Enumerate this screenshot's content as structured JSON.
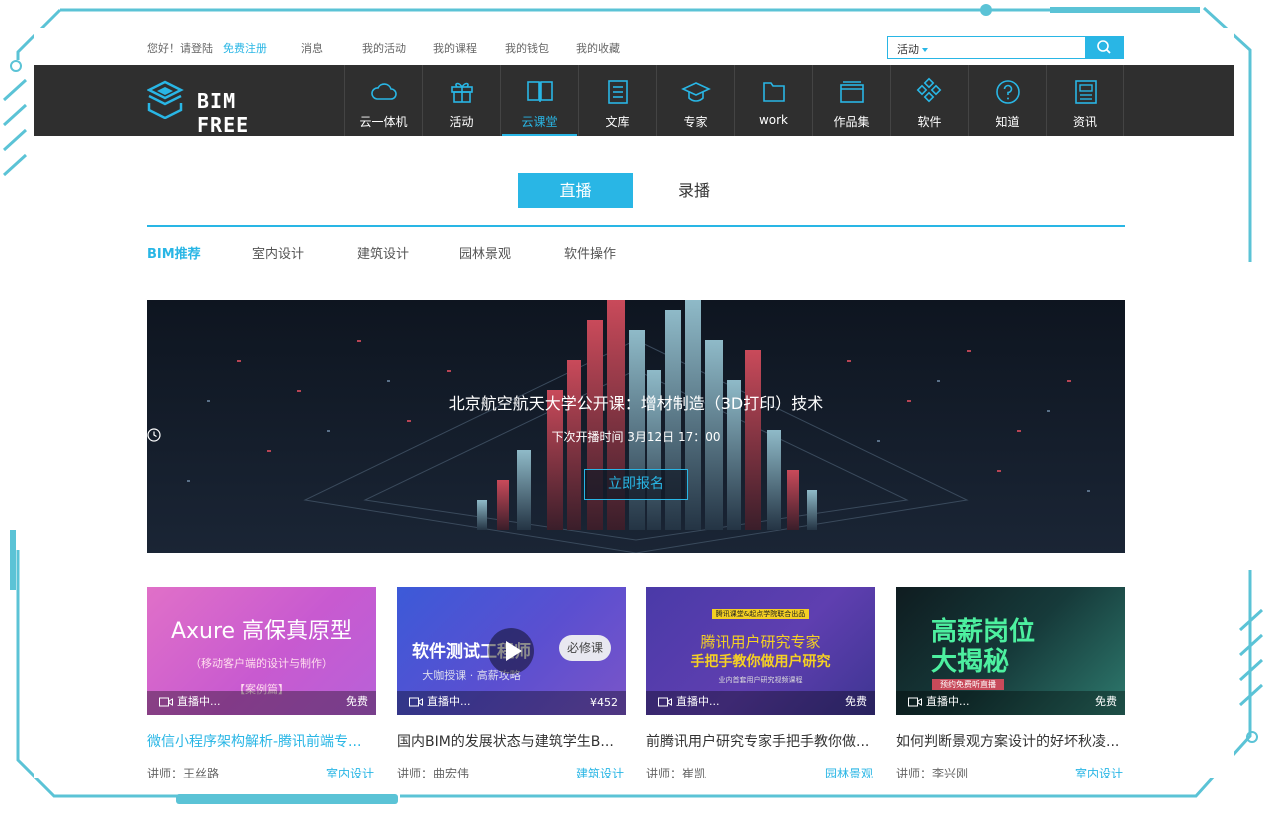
{
  "topbar": {
    "greeting": "您好！请登陆",
    "register": "免费注册",
    "links": [
      "消息",
      "我的活动",
      "我的课程",
      "我的钱包",
      "我的收藏"
    ]
  },
  "search": {
    "scope": "活动",
    "placeholder": ""
  },
  "brand": {
    "name": "BIM FREE"
  },
  "nav": [
    {
      "label": "云一体机",
      "icon": "cloud-icon"
    },
    {
      "label": "活动",
      "icon": "gift-icon"
    },
    {
      "label": "云课堂",
      "icon": "open-book-icon",
      "active": true
    },
    {
      "label": "文库",
      "icon": "document-icon"
    },
    {
      "label": "专家",
      "icon": "graduation-cap-icon"
    },
    {
      "label": "work",
      "icon": "folder-icon"
    },
    {
      "label": "作品集",
      "icon": "portfolio-icon"
    },
    {
      "label": "软件",
      "icon": "apps-diamond-icon"
    },
    {
      "label": "知道",
      "icon": "question-circle-icon"
    },
    {
      "label": "资讯",
      "icon": "news-icon"
    }
  ],
  "tabs": {
    "live": "直播",
    "recorded": "录播"
  },
  "categories": [
    "BIM推荐",
    "室内设计",
    "建筑设计",
    "园林景观",
    "软件操作"
  ],
  "banner": {
    "title": "北京航空航天大学公开课：增材制造（3D打印）技术",
    "next_time": "下次开播时间  3月12日  17：00",
    "cta": "立即报名"
  },
  "cards": [
    {
      "thumb_lines": [
        "Axure 高保真原型",
        "（移动客户端的设计与制作）",
        "【案例篇】"
      ],
      "status": "直播中...",
      "price": "免费",
      "title": "微信小程序架构解析-腾讯前端专...",
      "teacher": "讲师：王丝路",
      "category": "室内设计"
    },
    {
      "thumb_lines": [
        "软件测试工程师",
        "必修课",
        "大咖授课 · 高薪攻略"
      ],
      "status": "直播中...",
      "price": "¥452",
      "title": "国内BIM的发展状态与建筑学生B...",
      "teacher": "讲师：曲宏伟",
      "category": "建筑设计"
    },
    {
      "thumb_lines": [
        "腾讯课堂&起点学院联合出品",
        "腾讯用户研究专家",
        "手把手教你做用户研究",
        "业内首套用户研究视频课程"
      ],
      "status": "直播中...",
      "price": "免费",
      "title": "前腾讯用户研究专家手把手教你做...",
      "teacher": "讲师：崔凯",
      "category": "园林景观"
    },
    {
      "thumb_lines": [
        "高薪岗位",
        "大揭秘",
        "预约免费听直播"
      ],
      "status": "直播中...",
      "price": "免费",
      "title": "如何判断景观方案设计的好坏秋凌...",
      "teacher": "讲师：李兴刚",
      "category": "室内设计"
    }
  ],
  "colors": {
    "accent": "#29b6e5",
    "nav_bg": "#2f2f2f"
  }
}
